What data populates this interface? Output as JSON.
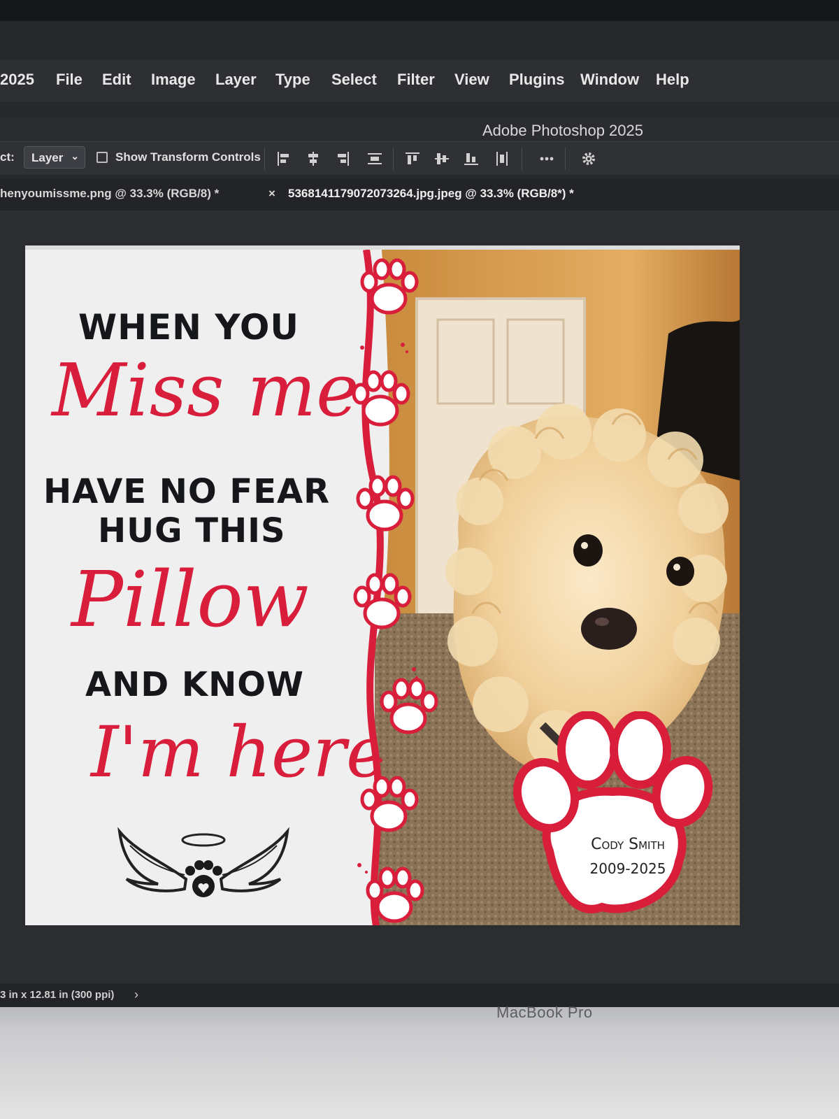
{
  "menubar": {
    "app_fragment": "2025",
    "items": [
      "File",
      "Edit",
      "Image",
      "Layer",
      "Type",
      "Select",
      "Filter",
      "View",
      "Plugins",
      "Window",
      "Help"
    ]
  },
  "titlebar": {
    "title": "Adobe Photoshop 2025"
  },
  "options": {
    "select_label": "ct:",
    "layer_value": "Layer",
    "transform_label": "Show Transform Controls"
  },
  "tabs": {
    "tab1": "henyoumissme.png @ 33.3% (RGB/8) *",
    "close_mark": "×",
    "tab2": "5368141179072073264.jpg.jpeg @ 33.3% (RGB/8*) *"
  },
  "artwork": {
    "line1": "WHEN YOU",
    "script1": "Miss me",
    "line2": "HAVE NO FEAR",
    "line3": "HUG THIS",
    "script2": "Pillow",
    "line4": "AND KNOW",
    "script3": "I'm here",
    "badge_name": "Cody Smith",
    "badge_years": "2009-2025",
    "accent": "#d81e3a"
  },
  "status": {
    "doc_size": "3 in x 12.81 in (300 ppi)",
    "arrow": "›"
  },
  "bezel": {
    "label": "MacBook Pro"
  }
}
